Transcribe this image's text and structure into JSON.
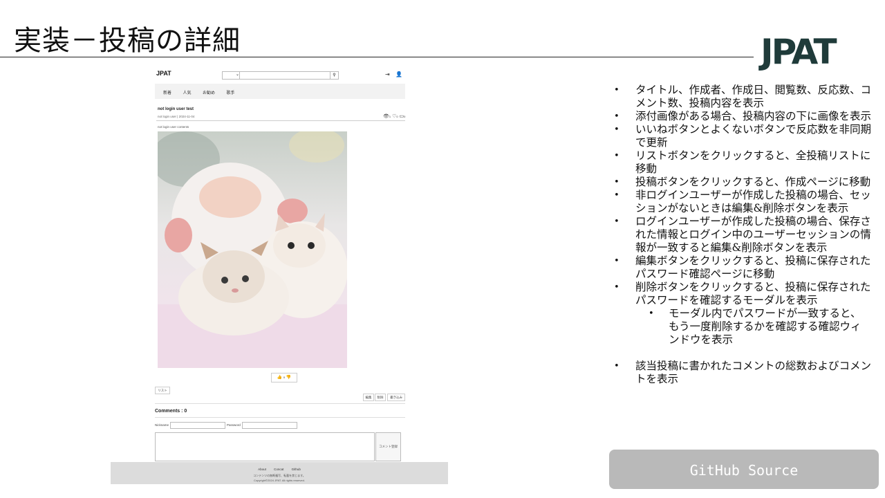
{
  "slide": {
    "title": "実装－投稿の詳細",
    "brand": "JPAT"
  },
  "screenshot": {
    "header": {
      "logo": "JPAT"
    },
    "nav": [
      "新着",
      "人気",
      "お勧め",
      "歌手"
    ],
    "post": {
      "title": "not login user test",
      "meta": "not login user | 2024-11-04",
      "content": "not login user contents",
      "views": "1",
      "likes": "0",
      "comments": "0",
      "reaction_count": "0"
    },
    "buttons": {
      "list": "リスト",
      "edit": "編集",
      "delete": "削除",
      "write": "書き込み"
    },
    "comments": {
      "count_label": "Comments : 0",
      "nickname_label": "Nickname",
      "password_label": "Password",
      "submit": "コメント登録"
    },
    "footer": {
      "links": [
        "About",
        "Concat",
        "Github"
      ],
      "line2": "コンテンツの無断複写、転載を禁じます。",
      "line3": "Copyright©2024 JPAT. All rights reserved."
    }
  },
  "bullets": [
    "タイトル、作成者、作成日、閲覧数、反応数、コメント数、投稿内容を表示",
    "添付画像がある場合、投稿内容の下に画像を表示",
    "いいねボタンとよくないボタンで反応数を非同期で更新",
    "リストボタンをクリックすると、全投稿リストに移動",
    "投稿ボタンをクリックすると、作成ページに移動",
    "非ログインユーザーが作成した投稿の場合、セッションがないときは編集&削除ボタンを表示",
    "ログインユーザーが作成した投稿の場合、保存された情報とログイン中のユーザーセッションの情報が一致すると編集&削除ボタンを表示",
    "編集ボタンをクリックすると、投稿に保存されたパスワード確認ページに移動",
    "削除ボタンをクリックすると、投稿に保存されたパスワードを確認するモーダルを表示",
    "モーダル内でパスワードが一致すると、もう一度削除するかを確認する確認ウィンドウを表示",
    "該当投稿に書かれたコメントの総数およびコメントを表示"
  ],
  "github_button": "GitHub Source"
}
